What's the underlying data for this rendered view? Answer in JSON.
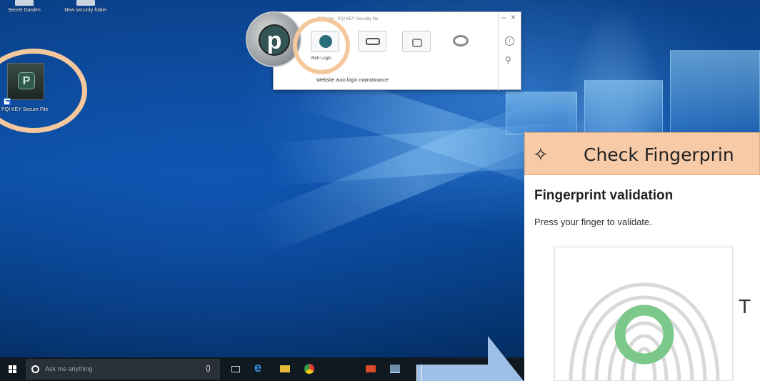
{
  "desktop": {
    "icons": [
      {
        "label": "Secret Garden"
      },
      {
        "label": "New security folder"
      }
    ],
    "shortcut_label": "PQI KEY Secure File"
  },
  "app_window": {
    "title": "PQI Key - PQI KEY Security file",
    "tool_label": "Web Login",
    "subtitle": "Website auto login maintainance",
    "controls": {
      "minimize": "–",
      "close": "×"
    },
    "side_icons": [
      "!",
      "⚲"
    ]
  },
  "taskbar": {
    "search_placeholder": "Ask me anything"
  },
  "fingerprint_card": {
    "header_icon": "✧",
    "header": "Check Fingerprin",
    "title": "Fingerprint validation",
    "instruction": "Press your finger to validate.",
    "accent_color": "#7cc88a",
    "header_color": "#f8cba8"
  },
  "highlight_color": "#f5c79c",
  "arrow_color": "#9dbfe8"
}
